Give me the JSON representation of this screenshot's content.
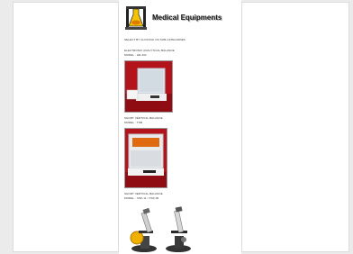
{
  "header": {
    "title": "Medical Equipments",
    "logo_icon": "chemistry-flask-logo-icon"
  },
  "intro": {
    "text": "SELECT BY CLICKING ON SUB-CATEGORIES"
  },
  "products": [
    {
      "name": "ELECTRONIC ANALYTICAL BALANCE",
      "model": "MODEL : HR-202"
    },
    {
      "name": "SHORT VERTICAL BALANCE",
      "model": "MODEL : TSB"
    },
    {
      "name": "SHORT VERTICAL BALANCE",
      "model": "MODEL : XSP-11 / XSP-06"
    }
  ]
}
